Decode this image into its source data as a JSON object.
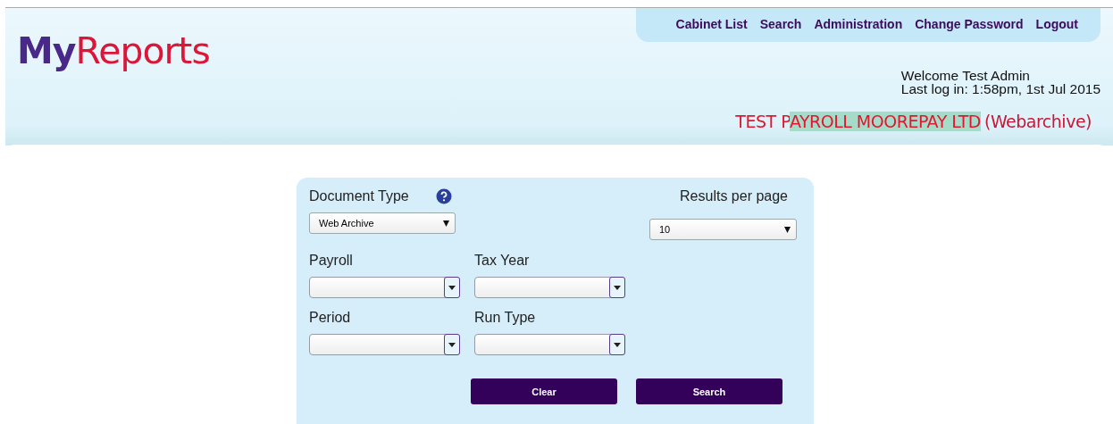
{
  "logo": [
    "My",
    "Reports"
  ],
  "nav": [
    "Cabinet List",
    "Search",
    "Administration",
    "Change Password",
    "Logout"
  ],
  "welcome": "Welcome Test Admin",
  "last_login": "Last log in: 1:58pm, 1st Jul 2015",
  "company": {
    "segments": [
      {
        "text": "TEST P",
        "highlighted": false
      },
      {
        "text": "AYROLL MOOREPAY LTD",
        "highlighted": true
      }
    ],
    "suffix": "(Webarchive)"
  },
  "form": {
    "document_type": {
      "label": "Document Type",
      "value": "Web Archive"
    },
    "results_per_page": {
      "label": "Results per page",
      "value": "10"
    },
    "fields": [
      {
        "label": "Payroll"
      },
      {
        "label": "Tax Year"
      },
      {
        "label": "Period"
      },
      {
        "label": "Run Type"
      }
    ],
    "buttons": [
      "Clear",
      "Search"
    ]
  }
}
